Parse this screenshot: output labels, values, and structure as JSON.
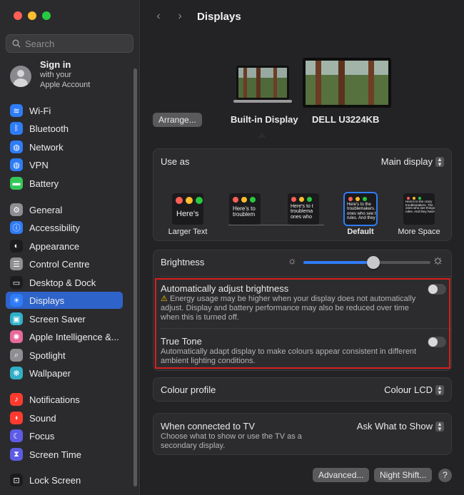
{
  "sidebar": {
    "search_placeholder": "Search",
    "signin": {
      "title": "Sign in",
      "line1": "with your",
      "line2": "Apple Account"
    },
    "items": [
      {
        "label": "Wi-Fi",
        "icon": "wifi-icon",
        "color": "#2f7cf6"
      },
      {
        "label": "Bluetooth",
        "icon": "bluetooth-icon",
        "color": "#2f7cf6"
      },
      {
        "label": "Network",
        "icon": "globe-icon",
        "color": "#2f7cf6"
      },
      {
        "label": "VPN",
        "icon": "vpn-icon",
        "color": "#2f7cf6"
      },
      {
        "label": "Battery",
        "icon": "battery-icon",
        "color": "#34c759"
      },
      {
        "label": "General",
        "icon": "gear-icon",
        "color": "#8e8e93"
      },
      {
        "label": "Accessibility",
        "icon": "accessibility-icon",
        "color": "#2f7cf6"
      },
      {
        "label": "Appearance",
        "icon": "appearance-icon",
        "color": "#1c1c1e"
      },
      {
        "label": "Control Centre",
        "icon": "control-centre-icon",
        "color": "#8e8e93"
      },
      {
        "label": "Desktop & Dock",
        "icon": "dock-icon",
        "color": "#1c1c1e"
      },
      {
        "label": "Displays",
        "icon": "sun-icon",
        "color": "#2f7cf6"
      },
      {
        "label": "Screen Saver",
        "icon": "screen-saver-icon",
        "color": "#30b0c7"
      },
      {
        "label": "Apple Intelligence &...",
        "icon": "apple-intelligence-icon",
        "color": "#e86a9a"
      },
      {
        "label": "Spotlight",
        "icon": "magnifier-icon",
        "color": "#8e8e93"
      },
      {
        "label": "Wallpaper",
        "icon": "wallpaper-icon",
        "color": "#30b0c7"
      },
      {
        "label": "Notifications",
        "icon": "bell-icon",
        "color": "#ff3b30"
      },
      {
        "label": "Sound",
        "icon": "speaker-icon",
        "color": "#ff3b30"
      },
      {
        "label": "Focus",
        "icon": "moon-icon",
        "color": "#5e5ce6"
      },
      {
        "label": "Screen Time",
        "icon": "hourglass-icon",
        "color": "#5e5ce6"
      },
      {
        "label": "Lock Screen",
        "icon": "lock-icon",
        "color": "#1c1c1e"
      }
    ]
  },
  "header": {
    "title": "Displays"
  },
  "displays": {
    "arrange_label": "Arrange...",
    "builtin": "Built-in Display",
    "external": "DELL U3224KB"
  },
  "use_as": {
    "label": "Use as",
    "value": "Main display",
    "options": [
      {
        "label": "Larger Text",
        "preview": "Here's"
      },
      {
        "label": "",
        "preview": "Here's to\ntroublem"
      },
      {
        "label": "",
        "preview": "Here's to t\ntroublema\nones who"
      },
      {
        "label": "Default",
        "preview": "Here's to the\ntroublemakers.\nones who see t\nrules. And they"
      },
      {
        "label": "More Space",
        "preview": "Here's to the crazy\ntroublemakers. The\nones who see things\nrules. And they have"
      }
    ]
  },
  "brightness": {
    "label": "Brightness",
    "level": 0.55,
    "auto_label": "Automatically adjust brightness",
    "auto_note_1": "Energy usage may be higher when your display does not automatically",
    "auto_note_2": "adjust. Display and battery performance may also be reduced over time",
    "auto_note_3": "when this is turned off.",
    "true_tone_label": "True Tone",
    "true_tone_note_1": "Automatically adapt display to make colours appear consistent in different",
    "true_tone_note_2": "ambient lighting conditions."
  },
  "colour_profile": {
    "label": "Colour profile",
    "value": "Colour LCD"
  },
  "tv": {
    "label": "When connected to TV",
    "note_1": "Choose what to show or use the TV as a",
    "note_2": "secondary display.",
    "value": "Ask What to Show"
  },
  "footer": {
    "advanced": "Advanced...",
    "night_shift": "Night Shift...",
    "help": "?"
  },
  "colors": {
    "accent": "#2e63c9",
    "highlight": "#d81e1e"
  }
}
